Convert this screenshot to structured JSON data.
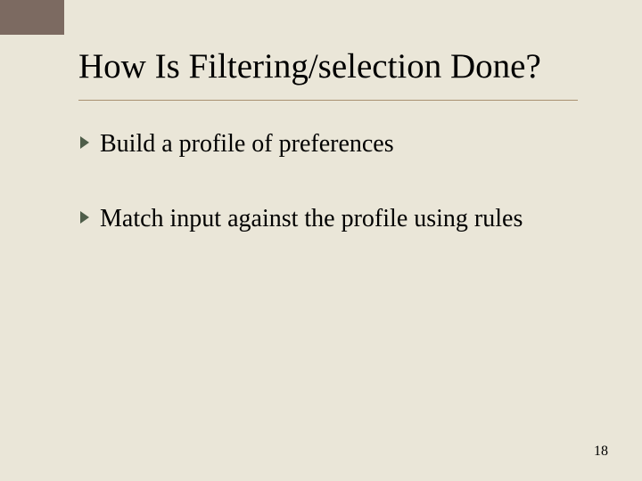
{
  "title": "How Is Filtering/selection Done?",
  "bullets": [
    "Build a profile of preferences",
    "Match input against the profile using rules"
  ],
  "page_number": "18",
  "colors": {
    "background": "#eae6d8",
    "corner": "#7c6a61",
    "rule": "#a89070",
    "bullet": "#4e5d49"
  }
}
